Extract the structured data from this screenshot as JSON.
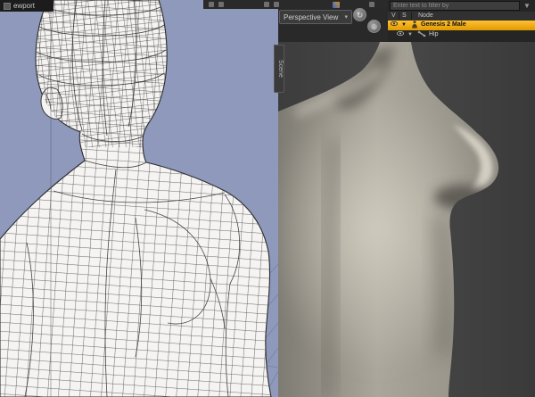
{
  "window": {
    "viewport_tab": "ewport"
  },
  "viewport_header": {
    "view_selector_label": "Perspective View",
    "dropdown_arrow": "▾",
    "nav_icons": [
      {
        "name": "orbit-camera",
        "glyph": "↻"
      },
      {
        "name": "frame-view",
        "glyph": "⊕"
      }
    ]
  },
  "scene_panel": {
    "filter_placeholder": "Enter text to filter by",
    "filter_icon": "▼",
    "columns": {
      "visibility": "V",
      "selected": "S",
      "node": "Node"
    },
    "rows": [
      {
        "eye": "👁",
        "expanded": "▼",
        "label": "Genesis 2 Male",
        "type": "figure"
      },
      {
        "eye": "👁",
        "expanded": "▼",
        "label": "Hip",
        "type": "bone"
      }
    ],
    "side_tab": "Scene"
  },
  "colors": {
    "viewport_bg": "#8e99bb",
    "selection": "#f0a500",
    "panel_bg": "#252525",
    "render_bg": "#414141"
  }
}
